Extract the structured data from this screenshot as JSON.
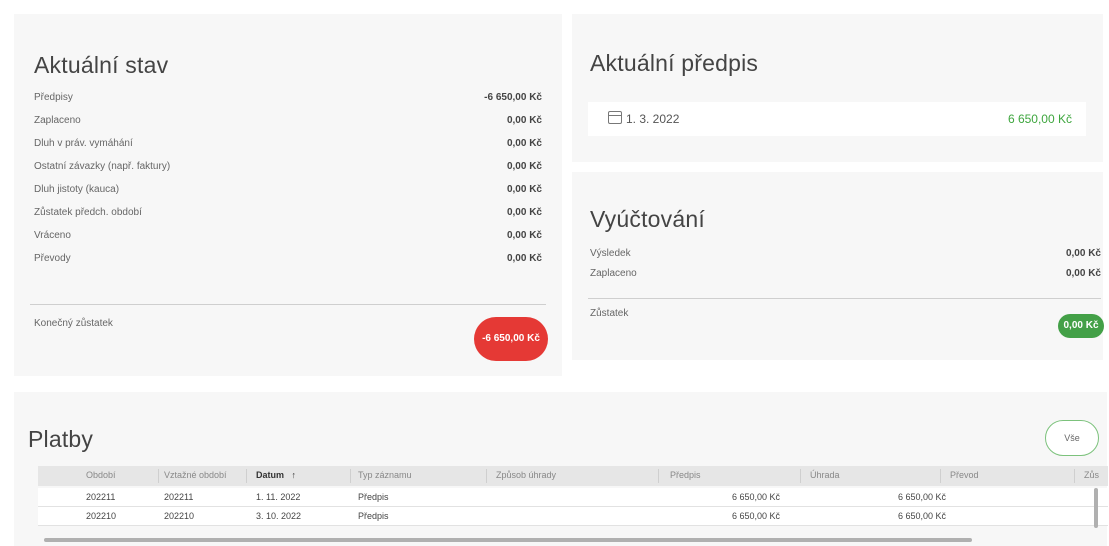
{
  "stav": {
    "title": "Aktuální stav",
    "rows": [
      {
        "label": "Předpisy",
        "value": "-6 650,00 Kč"
      },
      {
        "label": "Zaplaceno",
        "value": "0,00 Kč"
      },
      {
        "label": "Dluh v práv. vymáhání",
        "value": "0,00 Kč"
      },
      {
        "label": "Ostatní závazky (např. faktury)",
        "value": "0,00 Kč"
      },
      {
        "label": "Dluh jistoty (kauca)",
        "value": "0,00 Kč"
      },
      {
        "label": "Zůstatek předch. období",
        "value": "0,00 Kč"
      },
      {
        "label": "Vráceno",
        "value": "0,00 Kč"
      },
      {
        "label": "Převody",
        "value": "0,00 Kč"
      }
    ],
    "final_label": "Konečný zůstatek",
    "final_value": "-6 650,00 Kč",
    "final_color": "#e53935"
  },
  "predpis": {
    "title": "Aktuální předpis",
    "date": "1. 3. 2022",
    "amount": "6 650,00 Kč",
    "amount_color": "#3ea63e",
    "icon": "calendar-icon"
  },
  "vyuctovani": {
    "title": "Vyúčtování",
    "rows": [
      {
        "label": "Výsledek",
        "value": "0,00 Kč"
      },
      {
        "label": "Zaplaceno",
        "value": "0,00 Kč"
      }
    ],
    "final_label": "Zůstatek",
    "final_value": "0,00 Kč",
    "final_color": "#43a047"
  },
  "platby": {
    "title": "Platby",
    "all_button": "Vše",
    "columns": [
      "Období",
      "Vztažné období",
      "Datum",
      "Typ záznamu",
      "Způsob úhrady",
      "Předpis",
      "Úhrada",
      "Převod",
      "Zůs"
    ],
    "sorted_column": "Datum",
    "rows": [
      {
        "obdobi": "202211",
        "vztazne": "202211",
        "datum": "1. 11. 2022",
        "typ": "Předpis",
        "zpusob": "",
        "predpis": "6 650,00 Kč",
        "uhrada": "6 650,00 Kč",
        "prevod": ""
      },
      {
        "obdobi": "202210",
        "vztazne": "202210",
        "datum": "3. 10. 2022",
        "typ": "Předpis",
        "zpusob": "",
        "predpis": "6 650,00 Kč",
        "uhrada": "6 650,00 Kč",
        "prevod": ""
      }
    ]
  }
}
